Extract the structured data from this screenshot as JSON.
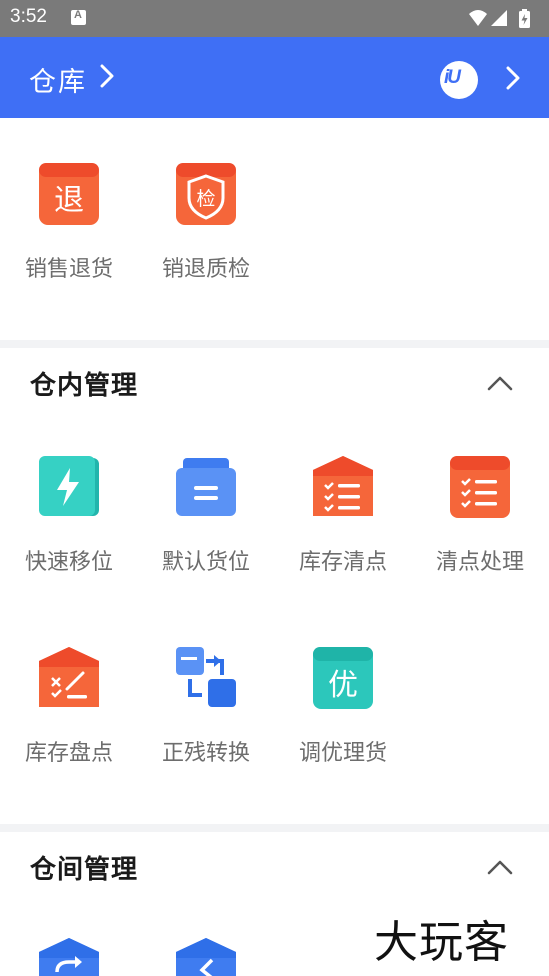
{
  "status_bar": {
    "time": "3:52",
    "notif_letter": "A"
  },
  "header": {
    "title": "仓库"
  },
  "section_top": {
    "items": [
      {
        "label": "销售退货",
        "glyph": "退",
        "icon": "return-icon"
      },
      {
        "label": "销退质检",
        "glyph": "检",
        "icon": "inspection-shield-icon"
      }
    ]
  },
  "section_inner": {
    "title": "仓内管理",
    "items": [
      {
        "label": "快速移位",
        "icon": "lightning-icon"
      },
      {
        "label": "默认货位",
        "icon": "default-slot-icon"
      },
      {
        "label": "库存清点",
        "icon": "inventory-count-icon"
      },
      {
        "label": "清点处理",
        "icon": "count-process-icon"
      },
      {
        "label": "库存盘点",
        "icon": "stocktake-icon"
      },
      {
        "label": "正残转换",
        "icon": "convert-icon"
      },
      {
        "label": "调优理货",
        "glyph": "优",
        "icon": "optimize-icon"
      }
    ]
  },
  "section_between": {
    "title": "仓间管理"
  },
  "watermark": "大玩客",
  "colors": {
    "primary": "#3f6ff5",
    "orange": "#f5663a",
    "teal": "#26c2b8",
    "blue": "#3f7cf0"
  }
}
